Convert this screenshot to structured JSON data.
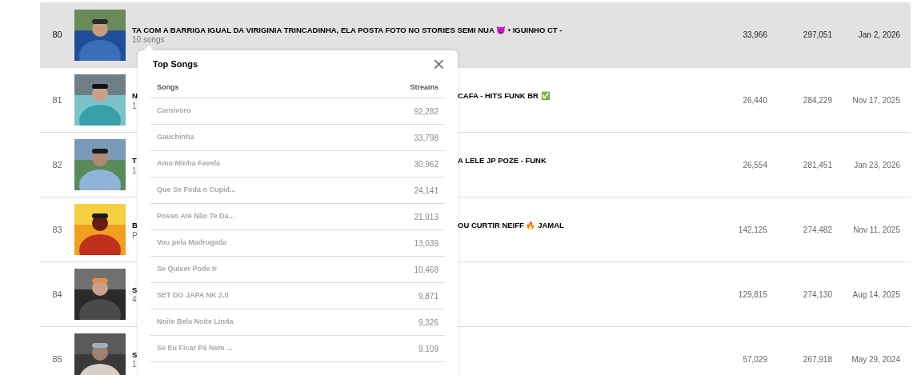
{
  "rows": [
    {
      "rank": "80",
      "selected": true,
      "title_parts": [
        "TA COM A BARRIGA IGUAL DA VIRIGINIA TRINCADINHA, ELA POSTA FOTO NO STORIES SEMI NUA 😈 • IGUINHO CT -"
      ],
      "subtitle": "10 songs",
      "column_4": "33,966",
      "column_5": "297,051",
      "date": "Jan 2, 2026"
    },
    {
      "rank": "81",
      "selected": false,
      "title_parts": [
        "N",
        "CAFA - HITS FUNK BR ✅"
      ],
      "subtitle": "1",
      "column_4": "26,440",
      "column_5": "284,229",
      "date": "Nov 17, 2025"
    },
    {
      "rank": "82",
      "selected": false,
      "title_parts": [
        "T",
        "A LELE JP POZE - FUNK"
      ],
      "subtitle": "1",
      "column_4": "26,554",
      "column_5": "281,451",
      "date": "Jan 23, 2026"
    },
    {
      "rank": "83",
      "selected": false,
      "title_parts": [
        "B",
        "OU CURTIR NEIFF 🔥 JAMAL"
      ],
      "subtitle": "P",
      "column_4": "142,125",
      "column_5": "274,482",
      "date": "Nov 11, 2025"
    },
    {
      "rank": "84",
      "selected": false,
      "title_parts": [
        "S"
      ],
      "subtitle": "4",
      "column_4": "129,815",
      "column_5": "274,130",
      "date": "Aug 14, 2025"
    },
    {
      "rank": "85",
      "selected": false,
      "title_parts": [
        "S"
      ],
      "subtitle": "1",
      "column_4": "57,029",
      "column_5": "267,918",
      "date": "May 29, 2024"
    }
  ],
  "popup": {
    "title": "Top Songs",
    "close": "×",
    "columns": [
      "Songs",
      "Streams"
    ],
    "songs": [
      {
        "name": "Carnivoro",
        "streams": "92,282"
      },
      {
        "name": "Gauchinha",
        "streams": "33,798"
      },
      {
        "name": "Amo Minha Favela",
        "streams": "30,962"
      },
      {
        "name": "Que Se Foda o Cupid...",
        "streams": "24,141"
      },
      {
        "name": "Posso Até Não Te Da...",
        "streams": "21,913"
      },
      {
        "name": "Vou pela Madrugada",
        "streams": "13,039"
      },
      {
        "name": "Se Quiser Pode Ir",
        "streams": "10,468"
      },
      {
        "name": "SET DO JAPA NK 2.0",
        "streams": "9,871"
      },
      {
        "name": "Noite Bela Noite Linda",
        "streams": "9,326"
      },
      {
        "name": "Se Eu Ficar Pá Nem ...",
        "streams": "9,109"
      }
    ]
  }
}
